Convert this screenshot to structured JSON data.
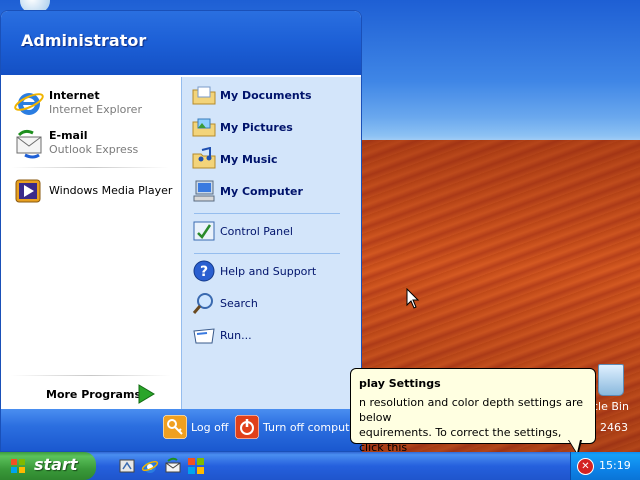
{
  "start_menu": {
    "user_name": "Administrator",
    "pinned": [
      {
        "title": "Internet",
        "subtitle": "Internet Explorer",
        "icon": "internet-explorer-icon"
      },
      {
        "title": "E-mail",
        "subtitle": "Outlook Express",
        "icon": "outlook-express-icon"
      }
    ],
    "recent": [
      {
        "label": "Windows Media Player",
        "icon": "windows-media-player-icon"
      }
    ],
    "more_programs": "More Programs",
    "right_items": [
      {
        "label": "My Documents",
        "bold": true,
        "icon": "my-documents-icon"
      },
      {
        "label": "My Pictures",
        "bold": true,
        "icon": "my-pictures-icon"
      },
      {
        "label": "My Music",
        "bold": true,
        "icon": "my-music-icon"
      },
      {
        "label": "My Computer",
        "bold": true,
        "icon": "my-computer-icon"
      },
      {
        "label": "Control Panel",
        "bold": false,
        "icon": "control-panel-icon"
      },
      {
        "label": "Help and Support",
        "bold": false,
        "icon": "help-icon"
      },
      {
        "label": "Search",
        "bold": false,
        "icon": "search-icon"
      },
      {
        "label": "Run...",
        "bold": false,
        "icon": "run-icon"
      }
    ],
    "log_off": "Log off",
    "turn_off": "Turn off computer"
  },
  "balloon": {
    "title": "play Settings",
    "line1": "n resolution and color depth settings are below",
    "line2": "equirements. To correct the settings, click this"
  },
  "desktop": {
    "recycle_label": "cle Bin",
    "number_text": "2463"
  },
  "taskbar": {
    "start_label": "start",
    "clock": "15:19",
    "quick_launch": [
      "show-desktop-icon",
      "internet-explorer-icon",
      "outlook-express-icon",
      "windows-media-player-icon"
    ]
  },
  "colors": {
    "start_green": "#3a9a3a",
    "taskbar_blue": "#2560dd",
    "menu_header_blue": "#1c5fd6",
    "right_pane": "#d3e5fa",
    "balloon_bg": "#ffffe1"
  }
}
